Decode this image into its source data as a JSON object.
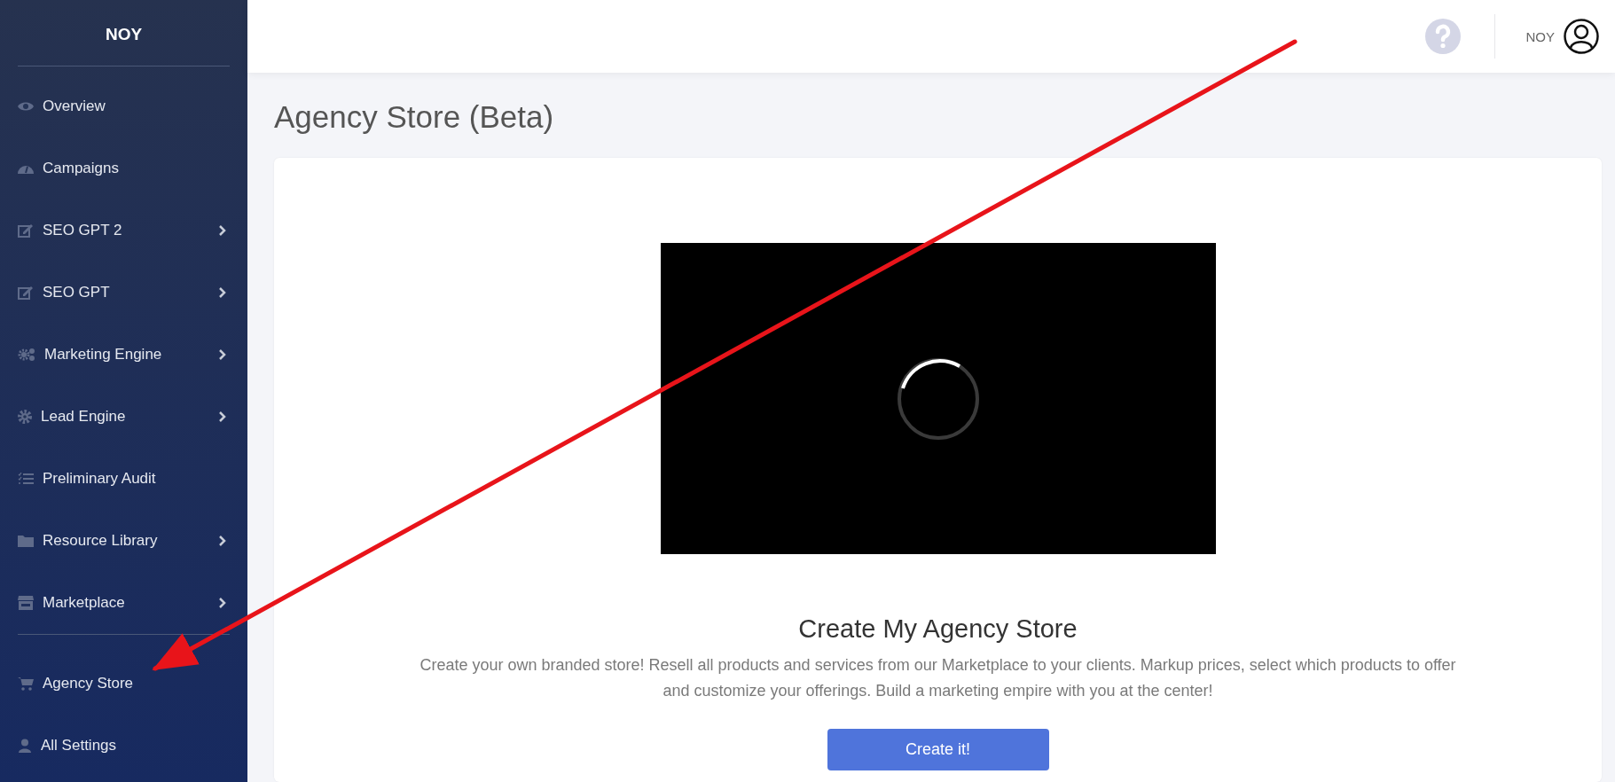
{
  "sidebar": {
    "brand": "NOY",
    "items": [
      {
        "kind": "link",
        "label": "Overview",
        "submenu": false
      },
      {
        "kind": "link",
        "label": "Campaigns",
        "submenu": false
      },
      {
        "kind": "link",
        "label": "SEO GPT 2",
        "submenu": true
      },
      {
        "kind": "link",
        "label": "SEO GPT",
        "submenu": true
      },
      {
        "kind": "link",
        "label": "Marketing Engine",
        "submenu": true
      },
      {
        "kind": "link",
        "label": "Lead Engine",
        "submenu": true
      },
      {
        "kind": "link",
        "label": "Preliminary Audit",
        "submenu": false
      },
      {
        "kind": "link",
        "label": "Resource Library",
        "submenu": true
      },
      {
        "kind": "link",
        "label": "Marketplace",
        "submenu": true
      },
      {
        "kind": "divider"
      },
      {
        "kind": "link",
        "label": "Agency Store",
        "submenu": false
      },
      {
        "kind": "link",
        "label": "All Settings",
        "submenu": false
      }
    ]
  },
  "header": {
    "user": "NOY"
  },
  "page_title": "Agency Store (Beta)",
  "card": {
    "heading": "Create My Agency Store",
    "text": "Create your own branded store! Resell all products and services from our Marketplace to your clients. Markup prices, select which products to offer and customize your offerings. Build a marketing empire with you at the center!",
    "button": "Create it!"
  },
  "annotation": {
    "kind": "arrow"
  }
}
